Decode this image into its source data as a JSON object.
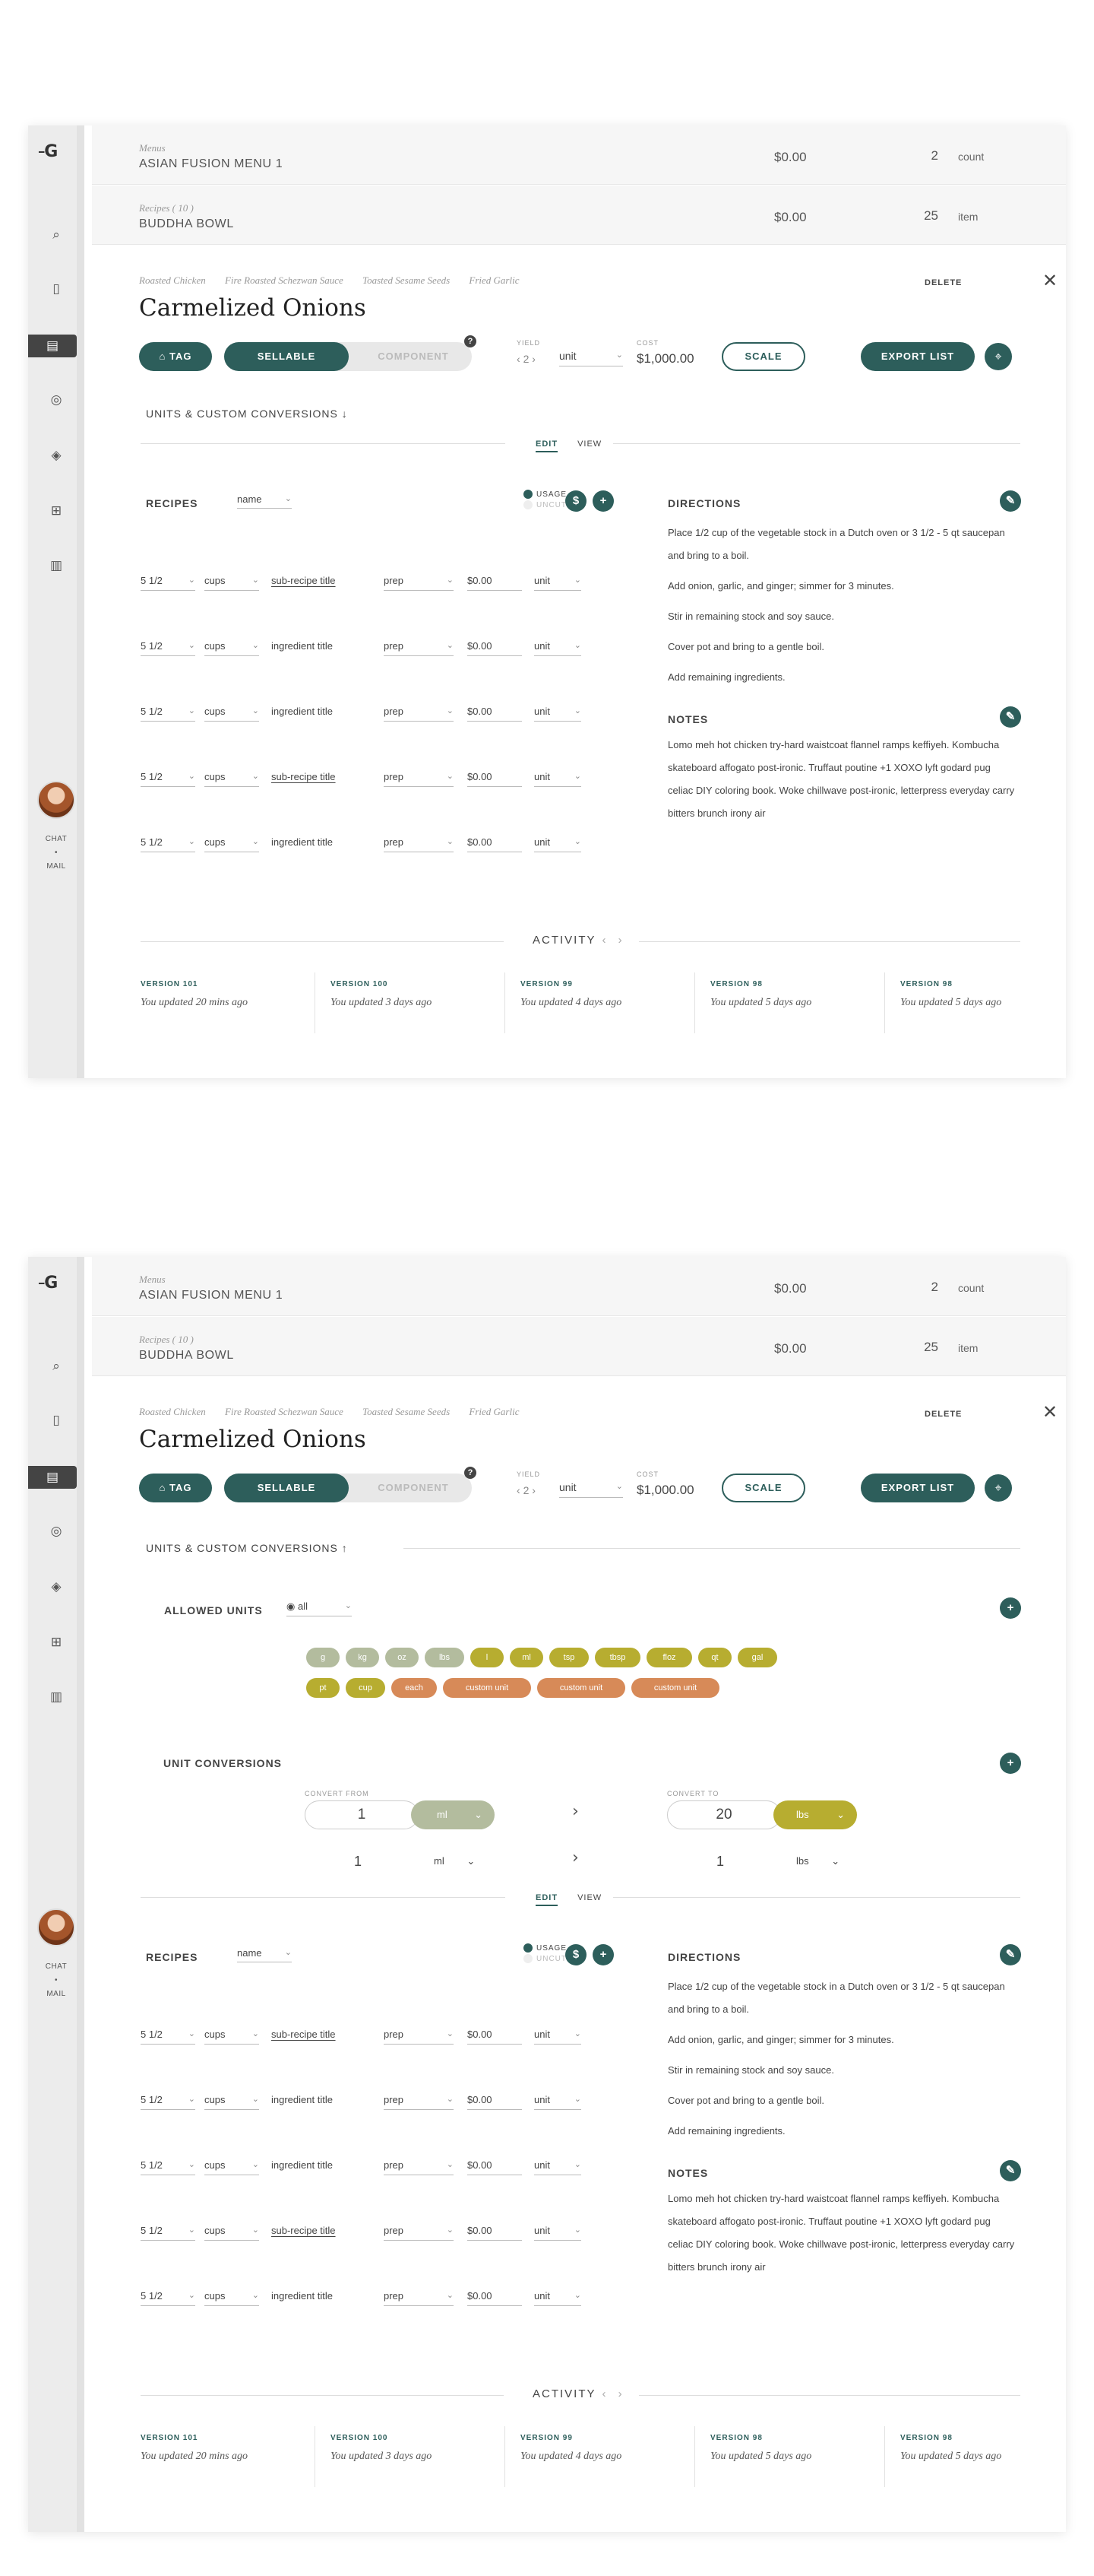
{
  "app": {
    "logo": "G",
    "chat": "CHAT",
    "dot": "•",
    "mail": "MAIL"
  },
  "rows": [
    {
      "label": "Menus",
      "title": "ASIAN FUSION MENU 1",
      "price": "$0.00",
      "qty": "2",
      "unit": "count"
    },
    {
      "label": "Recipes ( 10 )",
      "title": "BUDDHA BOWL",
      "price": "$0.00",
      "qty": "25",
      "unit": "item"
    }
  ],
  "detail": {
    "breadcrumbs": [
      "Roasted Chicken",
      "Fire Roasted Schezwan Sauce",
      "Toasted Sesame Seeds",
      "Fried Garlic"
    ],
    "delete": "DELETE",
    "close": "✕",
    "title": "Carmelized Onions",
    "tag": "TAG",
    "sellable": "SELLABLE",
    "component": "COMPONENT",
    "help": "?",
    "yield_label": "YIELD",
    "yield_value": "2",
    "yield_unit": "unit",
    "cost_label": "COST",
    "cost_value": "$1,000.00",
    "scale": "SCALE",
    "export": "EXPORT LIST",
    "units_header": "UNITS & CUSTOM CONVERSIONS",
    "arrow_down": "↓",
    "arrow_up": "↑",
    "edit": "EDIT",
    "view": "VIEW"
  },
  "recipes": {
    "title": "RECIPES",
    "sort": "name",
    "usage": "USAGE",
    "uncut": "UNCUT",
    "dollar": "$",
    "plus": "+",
    "ingredients": [
      {
        "qty": "5 1/2",
        "unit": "cups",
        "title": "sub-recipe title",
        "prep": "prep",
        "cost": "$0.00",
        "cunit": "unit",
        "sub": true
      },
      {
        "qty": "5 1/2",
        "unit": "cups",
        "title": "ingredient title",
        "prep": "prep",
        "cost": "$0.00",
        "cunit": "unit",
        "sub": false
      },
      {
        "qty": "5 1/2",
        "unit": "cups",
        "title": "ingredient title",
        "prep": "prep",
        "cost": "$0.00",
        "cunit": "unit",
        "sub": false
      },
      {
        "qty": "5 1/2",
        "unit": "cups",
        "title": "sub-recipe title",
        "prep": "prep",
        "cost": "$0.00",
        "cunit": "unit",
        "sub": true
      },
      {
        "qty": "5 1/2",
        "unit": "cups",
        "title": "ingredient title",
        "prep": "prep",
        "cost": "$0.00",
        "cunit": "unit",
        "sub": false
      }
    ]
  },
  "directions": {
    "title": "DIRECTIONS",
    "steps": [
      "Place 1/2 cup of the vegetable stock in a Dutch oven or 3 1/2 - 5 qt saucepan and bring to a boil.",
      "Add onion, garlic, and ginger; simmer for 3 minutes.",
      "Stir in remaining stock and soy sauce.",
      "Cover pot and bring to a gentle boil.",
      "Add remaining ingredients."
    ]
  },
  "notes": {
    "title": "NOTES",
    "text": "Lomo meh hot chicken try-hard waistcoat flannel ramps keffiyeh. Kombucha skateboard affogato post-ironic. Truffaut poutine +1 XOXO lyft godard pug celiac DIY coloring book. Woke chillwave post-ironic, letterpress everyday carry bitters brunch irony air"
  },
  "activity": {
    "title": "ACTIVITY",
    "nav": "‹ ›",
    "versions": [
      {
        "tag": "VERSION 101",
        "text": "You updated 20 mins ago"
      },
      {
        "tag": "VERSION 100",
        "text": "You updated 3 days ago"
      },
      {
        "tag": "VERSION 99",
        "text": "You updated 4 days ago"
      },
      {
        "tag": "VERSION 98",
        "text": "You updated 5 days ago"
      },
      {
        "tag": "VERSION 98",
        "text": "You updated 5 days ago"
      }
    ]
  },
  "units": {
    "allowed_title": "ALLOWED UNITS",
    "all": "all",
    "chips_row1": [
      {
        "label": "g",
        "color": "#b3bc9e"
      },
      {
        "label": "kg",
        "color": "#b3bc9e"
      },
      {
        "label": "oz",
        "color": "#b3bc9e"
      },
      {
        "label": "lbs",
        "color": "#b3bc9e"
      },
      {
        "label": "l",
        "color": "#b7ad30"
      },
      {
        "label": "ml",
        "color": "#b7ad30"
      },
      {
        "label": "tsp",
        "color": "#b7ad30"
      },
      {
        "label": "tbsp",
        "color": "#b7ad30"
      },
      {
        "label": "floz",
        "color": "#b7ad30"
      },
      {
        "label": "qt",
        "color": "#b7ad30"
      },
      {
        "label": "gal",
        "color": "#b7ad30"
      }
    ],
    "chips_row2": [
      {
        "label": "pt",
        "color": "#b7ad30"
      },
      {
        "label": "cup",
        "color": "#b7ad30"
      },
      {
        "label": "each",
        "color": "#d78a58"
      },
      {
        "label": "custom unit",
        "color": "#d78a58"
      },
      {
        "label": "custom unit",
        "color": "#d78a58"
      },
      {
        "label": "custom unit",
        "color": "#d78a58"
      }
    ],
    "conversions_title": "UNIT CONVERSIONS",
    "convert_from": "CONVERT FROM",
    "convert_to": "CONVERT TO",
    "from_value": "1",
    "from_unit": "ml",
    "to_value": "20",
    "to_unit": "lbs",
    "arrow": "›",
    "row2_from_value": "1",
    "row2_from_unit": "ml",
    "row2_to_value": "1",
    "row2_to_unit": "lbs"
  }
}
